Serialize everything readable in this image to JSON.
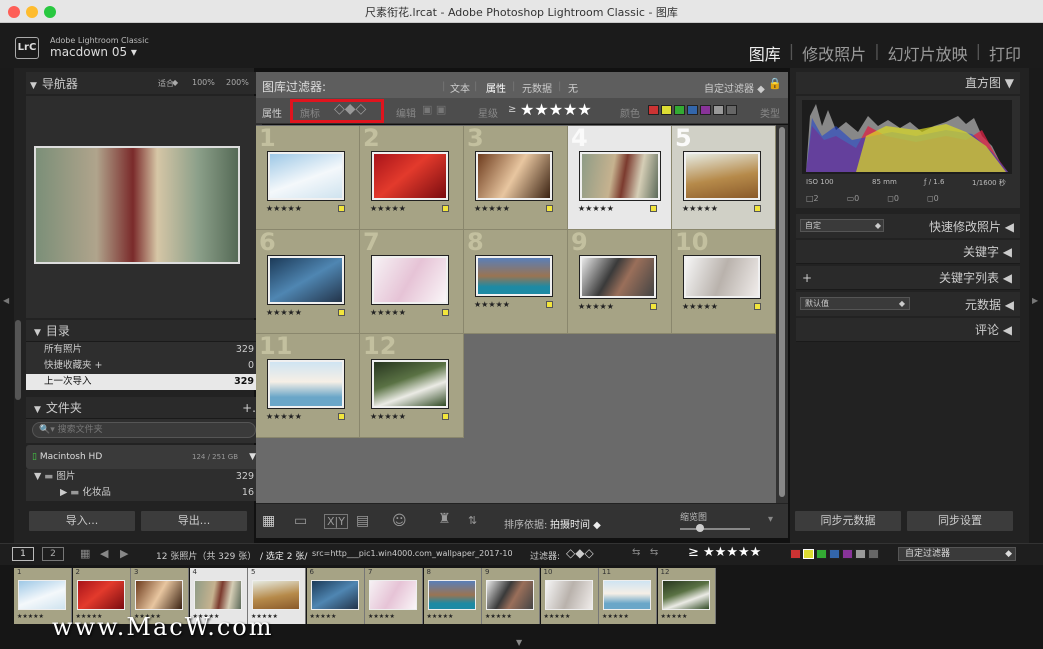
{
  "window": {
    "title": "尺素衔花.lrcat - Adobe Photoshop Lightroom Classic - 图库"
  },
  "identity": {
    "app_line": "Adobe Lightroom Classic",
    "user": "macdown 05",
    "logo": "LrC"
  },
  "modules": [
    "图库",
    "修改照片",
    "幻灯片放映",
    "打印"
  ],
  "navigator": {
    "title": "导航器",
    "zoom_fit": "适合",
    "zoom_100": "100%",
    "zoom_200": "200%"
  },
  "catalog": {
    "title": "目录",
    "items": [
      {
        "label": "所有照片",
        "count": "329"
      },
      {
        "label": "快捷收藏夹",
        "count": "0"
      },
      {
        "label": "上一次导入",
        "count": "329"
      }
    ]
  },
  "folders": {
    "title": "文件夹",
    "search_placeholder": "搜索文件夹",
    "drive": "Macintosh HD",
    "drive_size": "124 / 251 GB",
    "tree": [
      {
        "label": "图片",
        "count": "329"
      },
      {
        "label": "化妆品",
        "count": "16"
      }
    ]
  },
  "left_buttons": {
    "import": "导入...",
    "export": "导出..."
  },
  "filter_bar": {
    "title": "图库过滤器:",
    "modes": [
      "文本",
      "属性",
      "元数据",
      "无"
    ],
    "custom": "自定过滤器"
  },
  "attr_bar": {
    "label": "属性",
    "flag": "旗标",
    "edit": "编辑",
    "rating": "星级",
    "color": "颜色",
    "type": "类型"
  },
  "grid": {
    "cells": [
      {
        "n": "1"
      },
      {
        "n": "2"
      },
      {
        "n": "3"
      },
      {
        "n": "4"
      },
      {
        "n": "5"
      },
      {
        "n": "6"
      },
      {
        "n": "7"
      },
      {
        "n": "8"
      },
      {
        "n": "9"
      },
      {
        "n": "10"
      },
      {
        "n": "11"
      },
      {
        "n": "12"
      }
    ],
    "stars": "★★★★★"
  },
  "toolbar": {
    "sort_label": "排序依据:",
    "sort_value": "拍摄时间",
    "thumb_label": "缩览图"
  },
  "histogram": {
    "title": "直方图",
    "iso": "ISO 100",
    "focal": "85 mm",
    "aperture": "ƒ / 1.6",
    "shutter": "1/1600 秒"
  },
  "quick_develop": {
    "preset": "自定",
    "title": "快速修改照片"
  },
  "right_panels": {
    "keyword": "关键字",
    "keyword_list": "关键字列表",
    "metadata": "元数据",
    "metadata_preset": "默认值",
    "comments": "评论"
  },
  "right_buttons": {
    "sync_meta": "同步元数据",
    "sync_settings": "同步设置"
  },
  "filmstrip_bar": {
    "page1": "1",
    "page2": "2",
    "count_text": "12 张照片（共 329 张）",
    "selected": "/ 选定 2 张/",
    "src": "src=http___pic1.win4000.com_wallpaper_2017-10",
    "filter_label": "过滤器:",
    "custom": "自定过滤器"
  },
  "watermark": "www.MacW.com",
  "colors": {
    "accent": "#ff0000",
    "flag": "#f2e53c",
    "cell": "#a6a385"
  }
}
